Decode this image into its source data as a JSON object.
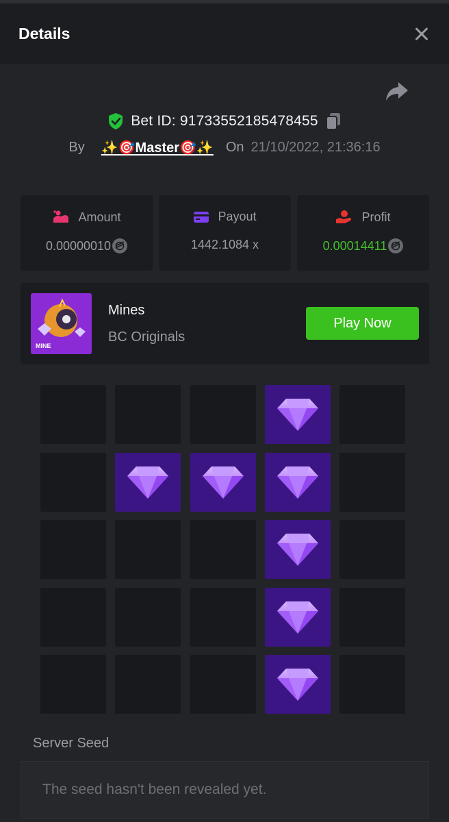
{
  "header": {
    "title": "Details"
  },
  "bet": {
    "id_label": "Bet ID: 91733552185478455",
    "by_label": "By",
    "user": "✨🎯Master🎯✨",
    "on_label": "On",
    "date": "21/10/2022, 21:36:16"
  },
  "stats": {
    "amount": {
      "label": "Amount",
      "value": "0.00000010",
      "icon": "coin-hand-icon"
    },
    "payout": {
      "label": "Payout",
      "value": "1442.1084 x",
      "icon": "card-icon"
    },
    "profit": {
      "label": "Profit",
      "value": "0.00014411",
      "icon": "hand-coin-icon"
    }
  },
  "game": {
    "thumb_label": "MINE",
    "name": "Mines",
    "provider": "BC Originals",
    "play_label": "Play Now"
  },
  "board": {
    "rows": 5,
    "cols": 5,
    "cells": [
      "empty",
      "empty",
      "empty",
      "gem",
      "empty",
      "empty",
      "gem",
      "gem",
      "gem",
      "empty",
      "empty",
      "empty",
      "empty",
      "gem",
      "empty",
      "empty",
      "empty",
      "empty",
      "gem",
      "empty",
      "empty",
      "empty",
      "empty",
      "gem",
      "empty"
    ]
  },
  "seed": {
    "label": "Server Seed",
    "value": "The seed hasn't been revealed yet."
  },
  "colors": {
    "background": "#232428",
    "panel": "#1b1c1f",
    "accent_green": "#3bc11f",
    "profit_green": "#43c12c",
    "gem_cell": "#3c1584",
    "verified_green": "#22c23a"
  }
}
